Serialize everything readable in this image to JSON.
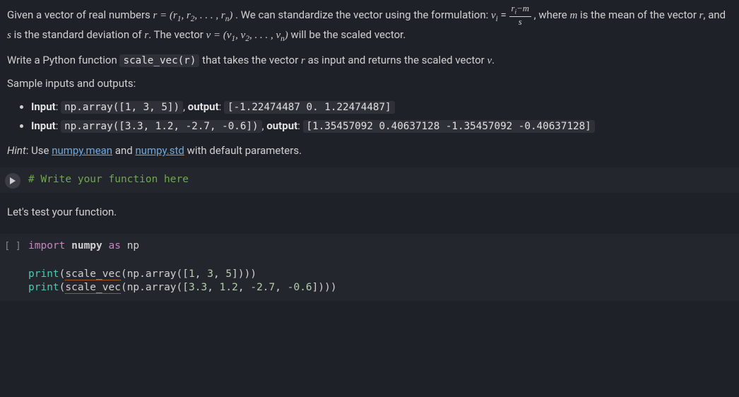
{
  "problem": {
    "p1_a": "Given a vector of real numbers ",
    "p1_r_eq": "r = (r",
    "p1_r_eq_mid": ", r",
    "p1_r_eq_dots": ", . . . , r",
    "p1_r_eq_close": ")",
    "p1_b": " . We can standardize the vector using the formulation: ",
    "p1_vi": "v",
    "p1_eq": " = ",
    "frac_num_a": "r",
    "frac_num_b": "−m",
    "frac_den": "s",
    "p1_c": " , where ",
    "p1_m": "m",
    "p1_d": " is the mean of the vector ",
    "p1_r": "r",
    "p1_e": ", and ",
    "p1_s": "s",
    "p1_f": " is the standard deviation of ",
    "p1_g": ". The vector ",
    "p1_veq": "v = (v",
    "p1_veq_mid": ", v",
    "p1_veq_dots": ", . . . , v",
    "p1_veq_close": ")",
    "p1_h": " will be the scaled vector.",
    "p2_a": "Write a Python function ",
    "p2_code": "scale_vec(r)",
    "p2_b": " that takes the vector ",
    "p2_c": " as input and returns the scaled vector ",
    "p2_v": "v",
    "p2_d": ".",
    "samples_heading": "Sample inputs and outputs:",
    "sample1_label_in": "Input",
    "sample1_in": "np.array([1, 3, 5])",
    "sample_out_label": "output",
    "sample1_out": "[-1.22474487 0. 1.22474487]",
    "sample2_in": "np.array([3.3, 1.2, -2.7, -0.6])",
    "sample2_out": "[1.35457092 0.40637128 -1.35457092 -0.40637128]",
    "hint_label": "Hint",
    "hint_a": ": Use ",
    "hint_link1": "numpy.mean",
    "hint_b": " and ",
    "hint_link2": "numpy.std",
    "hint_c": " with default parameters."
  },
  "cell1": {
    "comment": "# Write your function here"
  },
  "between_text": "Let's test your function.",
  "cell2": {
    "gutter": "[ ]",
    "line1_a": "import",
    "line1_b": " numpy ",
    "line1_c": "as",
    "line1_d": " np",
    "line_blank": "",
    "line3_a": "print",
    "line3_b": "(",
    "line3_c": "scale_vec",
    "line3_d": "(np.array([",
    "line3_e": "1",
    "line3_f": ", ",
    "line3_g": "3",
    "line3_h": ", ",
    "line3_i": "5",
    "line3_j": "])))",
    "line4_a": "print",
    "line4_b": "(",
    "line4_c": "scale_vec",
    "line4_d": "(np.array([",
    "line4_e": "3.3",
    "line4_f": ", ",
    "line4_g": "1.2",
    "line4_h": ", ",
    "line4_i": "-2.7",
    "line4_j": ", ",
    "line4_k": "-0.6",
    "line4_l": "])))"
  },
  "sub": {
    "1": "1",
    "2": "2",
    "n": "n",
    "i": "i"
  }
}
